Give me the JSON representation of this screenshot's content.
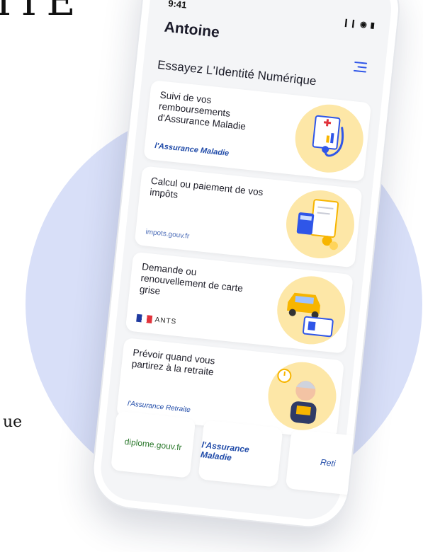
{
  "background": {
    "heading_fragment": "ITÉ",
    "side_text_fragment": "ue"
  },
  "phone": {
    "status_bar": {
      "time": "9:41",
      "indicators": "❙❙ ◉ ▮"
    },
    "user_name": "Antoine",
    "section_title": "Essayez L'Identité Numérique",
    "cards": [
      {
        "title": "Suivi de vos remboursements d'Assurance Maladie",
        "logo": "l'Assurance Maladie",
        "icon": "medical-stethoscope-icon"
      },
      {
        "title": "Calcul ou paiement de vos impôts",
        "logo": "impots.gouv.fr",
        "icon": "tax-calculator-icon"
      },
      {
        "title": "Demande ou renouvellement de carte grise",
        "logo": "ANTS",
        "icon": "car-id-card-icon"
      },
      {
        "title": "Prévoir quand vous partirez à la retraite",
        "logo": "l'Assurance Retraite",
        "icon": "retiree-knitting-icon"
      }
    ],
    "partners": [
      {
        "label": "diplome.gouv.fr"
      },
      {
        "label": "l'Assurance Maladie"
      },
      {
        "label": "Reti"
      }
    ]
  },
  "colors": {
    "accent": "#2f56e8",
    "circle_bg": "#d8dff8",
    "illustration_bg": "#fde7a7"
  }
}
